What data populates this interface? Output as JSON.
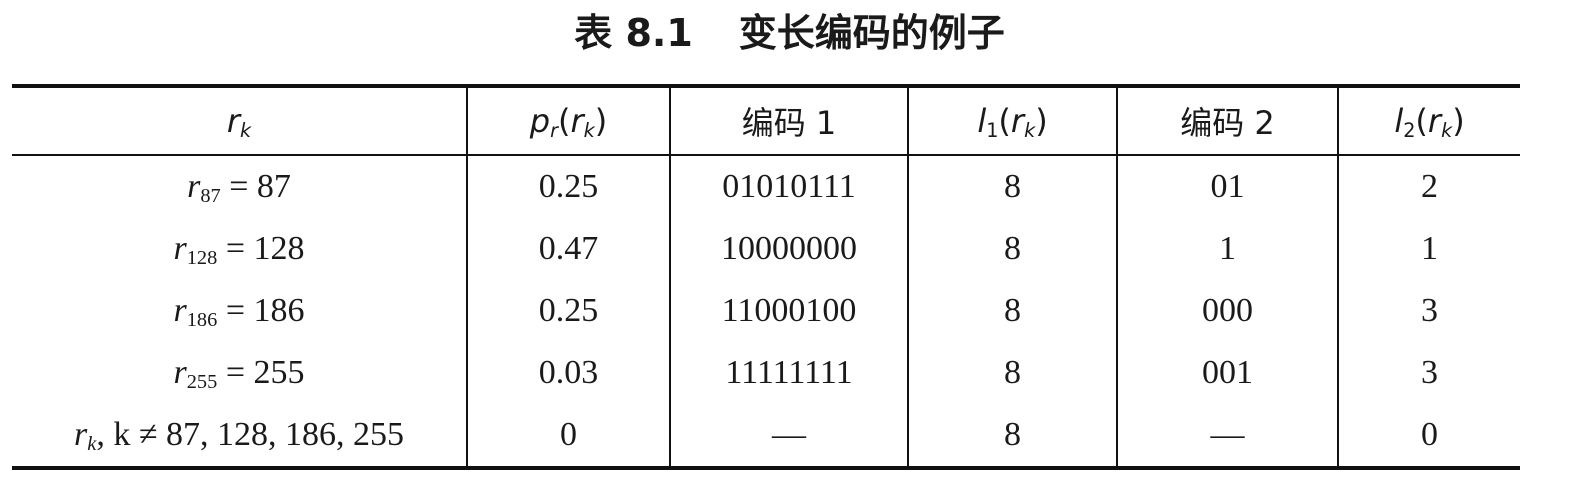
{
  "caption": {
    "number": "表 8.1",
    "title": "变长编码的例子"
  },
  "table": {
    "headers": [
      {
        "kind": "rk",
        "base": "r",
        "sub": "k"
      },
      {
        "kind": "func",
        "base": "p",
        "sub": "r",
        "arg_base": "r",
        "arg_sub": "k"
      },
      {
        "kind": "text",
        "text": "编码 1"
      },
      {
        "kind": "func",
        "base": "l",
        "sub": "1",
        "arg_base": "r",
        "arg_sub": "k"
      },
      {
        "kind": "text",
        "text": "编码 2"
      },
      {
        "kind": "func",
        "base": "l",
        "sub": "2",
        "arg_base": "r",
        "arg_sub": "k"
      }
    ],
    "rows": [
      {
        "rk": {
          "base": "r",
          "sub": "87",
          "rest": " = 87"
        },
        "pr": "0.25",
        "code1": "01010111",
        "l1": "8",
        "code2": "01",
        "l2": "2"
      },
      {
        "rk": {
          "base": "r",
          "sub": "128",
          "rest": " = 128"
        },
        "pr": "0.47",
        "code1": "10000000",
        "l1": "8",
        "code2": "1",
        "l2": "1"
      },
      {
        "rk": {
          "base": "r",
          "sub": "186",
          "rest": " = 186"
        },
        "pr": "0.25",
        "code1": "11000100",
        "l1": "8",
        "code2": "000",
        "l2": "3"
      },
      {
        "rk": {
          "base": "r",
          "sub": "255",
          "rest": " = 255"
        },
        "pr": "0.03",
        "code1": "11111111",
        "l1": "8",
        "code2": "001",
        "l2": "3"
      },
      {
        "rk": {
          "base": "r",
          "sub": "k",
          "rest": ", k ≠ 87, 128, 186, 255"
        },
        "pr": "0",
        "code1": "—",
        "l1": "8",
        "code2": "—",
        "l2": "0"
      }
    ]
  }
}
